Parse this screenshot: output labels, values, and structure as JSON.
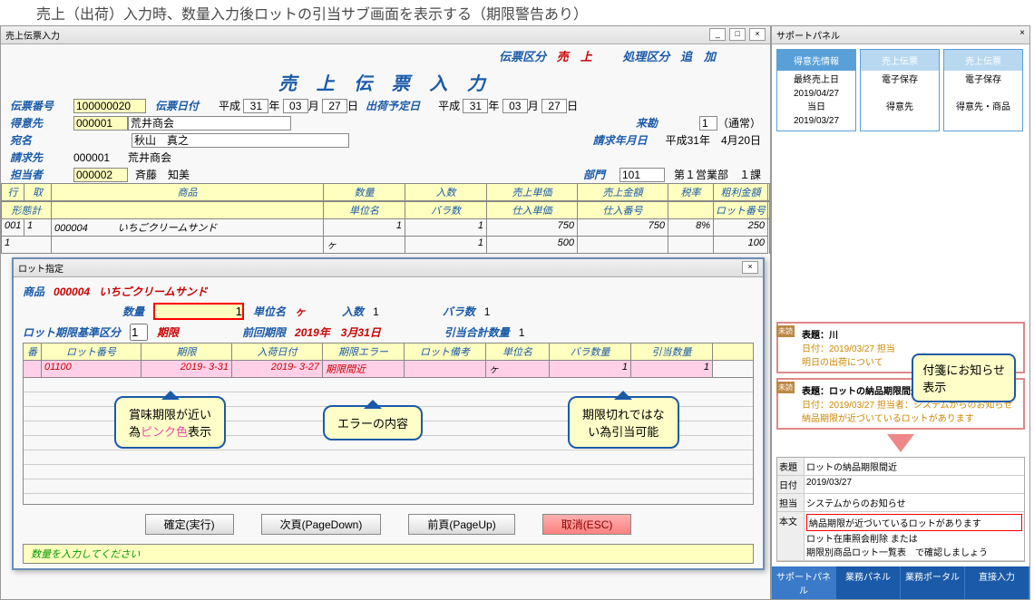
{
  "page_title": "売上（出荷）入力時、数量入力後ロットの引当サブ画面を表示する（期限警告あり）",
  "main_window": {
    "title": "売上伝票入力"
  },
  "top": {
    "denpyo_kubun_label": "伝票区分",
    "denpyo_kubun_value": "売　上",
    "shori_kubun_label": "処理区分",
    "shori_kubun_value": "追　加"
  },
  "doc_title": "売 上 伝 票 入 力",
  "form": {
    "denpyo_no_label": "伝票番号",
    "denpyo_no": "100000020",
    "denpyo_date_label": "伝票日付",
    "era": "平成",
    "y": "31",
    "m": "03",
    "d": "27",
    "ship_date_label": "出荷予定日",
    "ship_era": "平成",
    "ship_y": "31",
    "ship_m": "03",
    "ship_d": "27",
    "tokui_label": "得意先",
    "tokui_code": "000001",
    "tokui_name": "荒井商会",
    "raiten_label": "来勘",
    "raiten_val": "1",
    "raiten_txt": "（通常）",
    "atena_label": "宛名",
    "atena_val": "秋山　真之",
    "seikyu_date_label": "請求年月日",
    "seikyu_date_val": "平成31年　4月20日",
    "seikyu_label": "請求先",
    "seikyu_code": "000001",
    "seikyu_name": "荒井商会",
    "tantou_label": "担当者",
    "tantou_code": "000002",
    "tantou_name": "斉藤　知美",
    "bumon_label": "部門",
    "bumon_code": "101",
    "bumon_name": "第１営業部　１課"
  },
  "grid": {
    "h": [
      "行",
      "取",
      "商品",
      "数量",
      "入数",
      "売上単価",
      "売上金額",
      "税率",
      "粗利金額"
    ],
    "h2": [
      "形態計",
      "",
      "単位名",
      "バラ数",
      "仕入単価",
      "仕入番号",
      "",
      "ロット番号"
    ],
    "row1": {
      "line": "001",
      "tori": "1",
      "code": "000004",
      "name": "いちごクリームサンド",
      "qty": "1",
      "nyu": "1",
      "tanka": "750",
      "kingaku": "750",
      "zei": "8%",
      "arari": "250"
    },
    "row2": {
      "keitai": "1",
      "unit": "ヶ",
      "bara": "1",
      "shiire": "500",
      "lot": "100"
    }
  },
  "subwin": {
    "title": "ロット指定",
    "item_label": "商品",
    "item_code": "000004",
    "item_name": "いちごクリームサンド",
    "qty_label": "数量",
    "qty_val": "1",
    "unit_label": "単位名",
    "unit_val": "ヶ",
    "nyu_label": "入数",
    "nyu_val": "1",
    "bara_label": "バラ数",
    "bara_val": "1",
    "base_label": "ロット期限基準区分",
    "base_val": "1",
    "base_txt": "期限",
    "prev_label": "前回期限",
    "prev_val": "2019年　3月31日",
    "total_label": "引当合計数量",
    "total_val": "1",
    "cols": [
      "番",
      "ロット番号",
      "期限",
      "入荷日付",
      "期限エラー",
      "ロット備考",
      "単位名",
      "バラ数量",
      "引当数量"
    ],
    "row": {
      "no": "",
      "lot": "01100",
      "limit": "2019- 3-31",
      "arrive": "2019- 3-27",
      "err": "期限間近",
      "memo": "",
      "unit": "ヶ",
      "bara": "1",
      "hiki": "1"
    },
    "btn_confirm": "確定(実行)",
    "btn_next": "次頁(PageDown)",
    "btn_prev": "前頁(PageUp)",
    "btn_cancel": "取消(ESC)",
    "status": "数量を入力してください"
  },
  "callouts": {
    "c1a": "賞味期限が近い",
    "c1b": "為",
    "c1c": "ピンク色",
    "c1d": "表示",
    "c2": "エラーの内容",
    "c3a": "期限切れではな",
    "c3b": "い為引当可能",
    "c4a": "付箋にお知らせ",
    "c4b": "表示"
  },
  "support": {
    "title": "サポートパネル",
    "tiles": [
      {
        "h": "得意先情報",
        "l1": "最終売上日",
        "l2": "2019/04/27",
        "l3": "当日",
        "l4": "2019/03/27"
      },
      {
        "h": "売上伝票",
        "l1": "電子保存",
        "l2": "",
        "l3": "得意先",
        "l4": ""
      },
      {
        "h": "売上伝票",
        "l1": "電子保存",
        "l2": "",
        "l3": "得意先・商品",
        "l4": ""
      }
    ],
    "memo1": {
      "title": "表題：川",
      "line1": "日付：2019/03/27 担当",
      "line2": "明日の出荷について"
    },
    "memo2": {
      "title": "表題：ロットの納品期限間近",
      "line1": "日付：2019/03/27 担当者：システムからのお知らせ",
      "line2": "納品期限が近づいているロットがあります"
    },
    "detail": {
      "subj_l": "表題",
      "subj": "ロットの納品期限間近",
      "date_l": "日付",
      "date": "2019/03/27",
      "tantou_l": "担当",
      "tantou": "システムからのお知らせ",
      "body_l": "本文",
      "body1": "納品期限が近づいているロットがあります",
      "body2": "ロット在庫照会削除 または",
      "body3": "期限別商品ロット一覧表　で確認しましょう"
    },
    "tabs": [
      "サポートパネル",
      "業務パネル",
      "業務ポータル",
      "直接入力"
    ]
  }
}
